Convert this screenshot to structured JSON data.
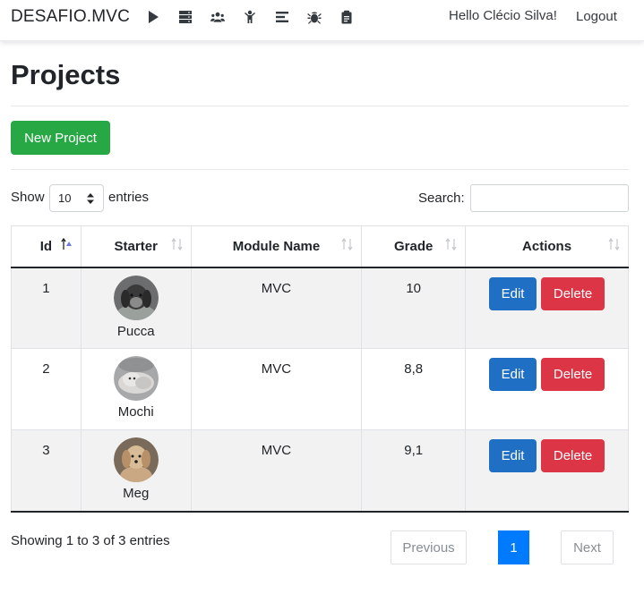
{
  "navbar": {
    "brand": "DESAFIO.MVC",
    "icons": [
      "play-icon",
      "server-icon",
      "users-icon",
      "child-icon",
      "align-icon",
      "bug-icon",
      "clipboard-icon"
    ],
    "greeting": "Hello Clécio Silva!",
    "logout": "Logout"
  },
  "page": {
    "title": "Projects",
    "new_button": "New Project"
  },
  "table_controls": {
    "show_label": "Show",
    "page_size": "10",
    "entries_label": "entries",
    "search_label": "Search:",
    "search_value": ""
  },
  "table": {
    "columns": [
      "Id",
      "Starter",
      "Module Name",
      "Grade",
      "Actions"
    ],
    "sort_column": "Id",
    "sort_direction": "ascending",
    "rows": [
      {
        "id": "1",
        "starter": "Pucca",
        "module": "MVC",
        "grade": "10",
        "edit": "Edit",
        "delete": "Delete"
      },
      {
        "id": "2",
        "starter": "Mochi",
        "module": "MVC",
        "grade": "8,8",
        "edit": "Edit",
        "delete": "Delete"
      },
      {
        "id": "3",
        "starter": "Meg",
        "module": "MVC",
        "grade": "9,1",
        "edit": "Edit",
        "delete": "Delete"
      }
    ]
  },
  "footer": {
    "info": "Showing 1 to 3 of 3 entries",
    "previous": "Previous",
    "current_page": "1",
    "next": "Next"
  },
  "colors": {
    "primary": "#007bff",
    "success": "#28a745",
    "danger": "#dc3545",
    "edit": "#1f6fc5"
  }
}
